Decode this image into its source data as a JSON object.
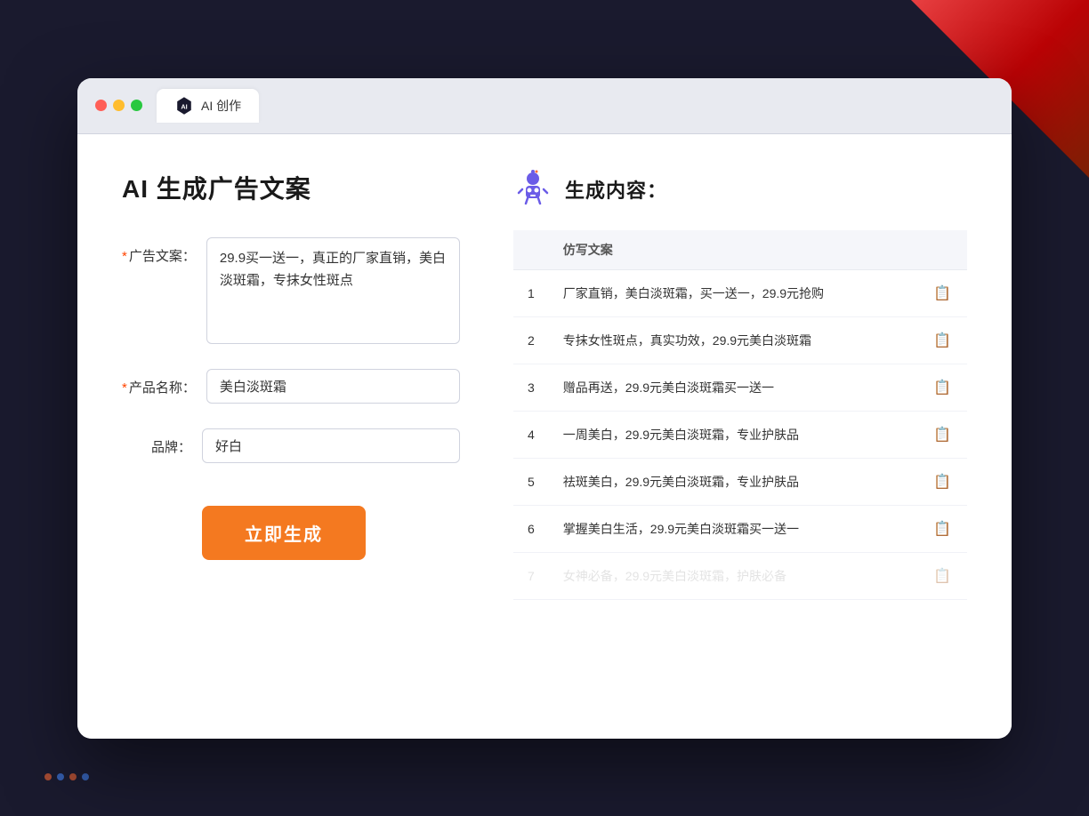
{
  "window": {
    "tab_label": "AI 创作"
  },
  "left_panel": {
    "page_title": "AI 生成广告文案",
    "form": {
      "ad_copy_label": "广告文案：",
      "ad_copy_required": "*",
      "ad_copy_value": "29.9买一送一，真正的厂家直销，美白淡斑霜，专抹女性斑点",
      "product_name_label": "产品名称：",
      "product_name_required": "*",
      "product_name_value": "美白淡斑霜",
      "brand_label": "品牌：",
      "brand_value": "好白"
    },
    "generate_btn_label": "立即生成"
  },
  "right_panel": {
    "result_title": "生成内容：",
    "table_header": "仿写文案",
    "results": [
      {
        "num": "1",
        "text": "厂家直销，美白淡斑霜，买一送一，29.9元抢购"
      },
      {
        "num": "2",
        "text": "专抹女性斑点，真实功效，29.9元美白淡斑霜"
      },
      {
        "num": "3",
        "text": "赠品再送，29.9元美白淡斑霜买一送一"
      },
      {
        "num": "4",
        "text": "一周美白，29.9元美白淡斑霜，专业护肤品"
      },
      {
        "num": "5",
        "text": "祛斑美白，29.9元美白淡斑霜，专业护肤品"
      },
      {
        "num": "6",
        "text": "掌握美白生活，29.9元美白淡斑霜买一送一"
      },
      {
        "num": "7",
        "text": "女神必备，29.9元美白淡斑霜，护肤必备",
        "faded": true
      }
    ]
  }
}
